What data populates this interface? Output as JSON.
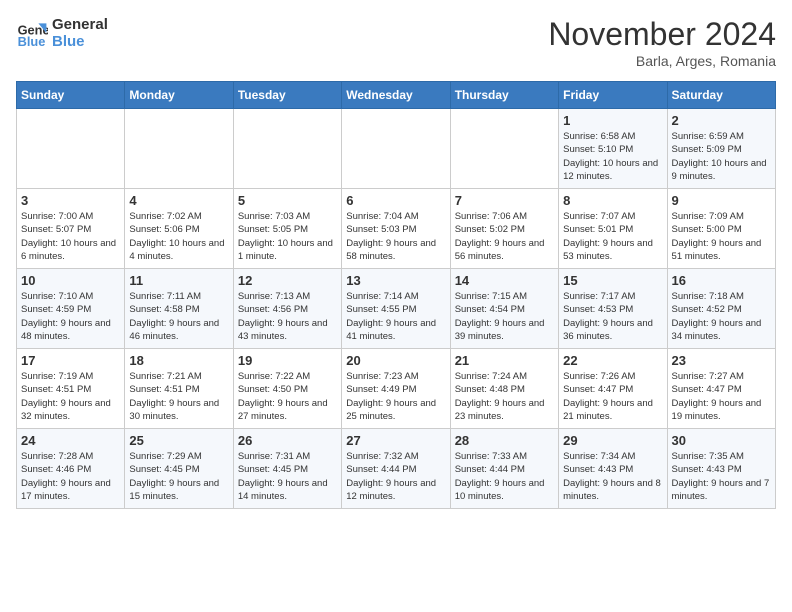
{
  "logo": {
    "text_general": "General",
    "text_blue": "Blue"
  },
  "header": {
    "month": "November 2024",
    "location": "Barla, Arges, Romania"
  },
  "weekdays": [
    "Sunday",
    "Monday",
    "Tuesday",
    "Wednesday",
    "Thursday",
    "Friday",
    "Saturday"
  ],
  "weeks": [
    [
      {
        "day": "",
        "info": ""
      },
      {
        "day": "",
        "info": ""
      },
      {
        "day": "",
        "info": ""
      },
      {
        "day": "",
        "info": ""
      },
      {
        "day": "",
        "info": ""
      },
      {
        "day": "1",
        "info": "Sunrise: 6:58 AM\nSunset: 5:10 PM\nDaylight: 10 hours and 12 minutes."
      },
      {
        "day": "2",
        "info": "Sunrise: 6:59 AM\nSunset: 5:09 PM\nDaylight: 10 hours and 9 minutes."
      }
    ],
    [
      {
        "day": "3",
        "info": "Sunrise: 7:00 AM\nSunset: 5:07 PM\nDaylight: 10 hours and 6 minutes."
      },
      {
        "day": "4",
        "info": "Sunrise: 7:02 AM\nSunset: 5:06 PM\nDaylight: 10 hours and 4 minutes."
      },
      {
        "day": "5",
        "info": "Sunrise: 7:03 AM\nSunset: 5:05 PM\nDaylight: 10 hours and 1 minute."
      },
      {
        "day": "6",
        "info": "Sunrise: 7:04 AM\nSunset: 5:03 PM\nDaylight: 9 hours and 58 minutes."
      },
      {
        "day": "7",
        "info": "Sunrise: 7:06 AM\nSunset: 5:02 PM\nDaylight: 9 hours and 56 minutes."
      },
      {
        "day": "8",
        "info": "Sunrise: 7:07 AM\nSunset: 5:01 PM\nDaylight: 9 hours and 53 minutes."
      },
      {
        "day": "9",
        "info": "Sunrise: 7:09 AM\nSunset: 5:00 PM\nDaylight: 9 hours and 51 minutes."
      }
    ],
    [
      {
        "day": "10",
        "info": "Sunrise: 7:10 AM\nSunset: 4:59 PM\nDaylight: 9 hours and 48 minutes."
      },
      {
        "day": "11",
        "info": "Sunrise: 7:11 AM\nSunset: 4:58 PM\nDaylight: 9 hours and 46 minutes."
      },
      {
        "day": "12",
        "info": "Sunrise: 7:13 AM\nSunset: 4:56 PM\nDaylight: 9 hours and 43 minutes."
      },
      {
        "day": "13",
        "info": "Sunrise: 7:14 AM\nSunset: 4:55 PM\nDaylight: 9 hours and 41 minutes."
      },
      {
        "day": "14",
        "info": "Sunrise: 7:15 AM\nSunset: 4:54 PM\nDaylight: 9 hours and 39 minutes."
      },
      {
        "day": "15",
        "info": "Sunrise: 7:17 AM\nSunset: 4:53 PM\nDaylight: 9 hours and 36 minutes."
      },
      {
        "day": "16",
        "info": "Sunrise: 7:18 AM\nSunset: 4:52 PM\nDaylight: 9 hours and 34 minutes."
      }
    ],
    [
      {
        "day": "17",
        "info": "Sunrise: 7:19 AM\nSunset: 4:51 PM\nDaylight: 9 hours and 32 minutes."
      },
      {
        "day": "18",
        "info": "Sunrise: 7:21 AM\nSunset: 4:51 PM\nDaylight: 9 hours and 30 minutes."
      },
      {
        "day": "19",
        "info": "Sunrise: 7:22 AM\nSunset: 4:50 PM\nDaylight: 9 hours and 27 minutes."
      },
      {
        "day": "20",
        "info": "Sunrise: 7:23 AM\nSunset: 4:49 PM\nDaylight: 9 hours and 25 minutes."
      },
      {
        "day": "21",
        "info": "Sunrise: 7:24 AM\nSunset: 4:48 PM\nDaylight: 9 hours and 23 minutes."
      },
      {
        "day": "22",
        "info": "Sunrise: 7:26 AM\nSunset: 4:47 PM\nDaylight: 9 hours and 21 minutes."
      },
      {
        "day": "23",
        "info": "Sunrise: 7:27 AM\nSunset: 4:47 PM\nDaylight: 9 hours and 19 minutes."
      }
    ],
    [
      {
        "day": "24",
        "info": "Sunrise: 7:28 AM\nSunset: 4:46 PM\nDaylight: 9 hours and 17 minutes."
      },
      {
        "day": "25",
        "info": "Sunrise: 7:29 AM\nSunset: 4:45 PM\nDaylight: 9 hours and 15 minutes."
      },
      {
        "day": "26",
        "info": "Sunrise: 7:31 AM\nSunset: 4:45 PM\nDaylight: 9 hours and 14 minutes."
      },
      {
        "day": "27",
        "info": "Sunrise: 7:32 AM\nSunset: 4:44 PM\nDaylight: 9 hours and 12 minutes."
      },
      {
        "day": "28",
        "info": "Sunrise: 7:33 AM\nSunset: 4:44 PM\nDaylight: 9 hours and 10 minutes."
      },
      {
        "day": "29",
        "info": "Sunrise: 7:34 AM\nSunset: 4:43 PM\nDaylight: 9 hours and 8 minutes."
      },
      {
        "day": "30",
        "info": "Sunrise: 7:35 AM\nSunset: 4:43 PM\nDaylight: 9 hours and 7 minutes."
      }
    ]
  ]
}
